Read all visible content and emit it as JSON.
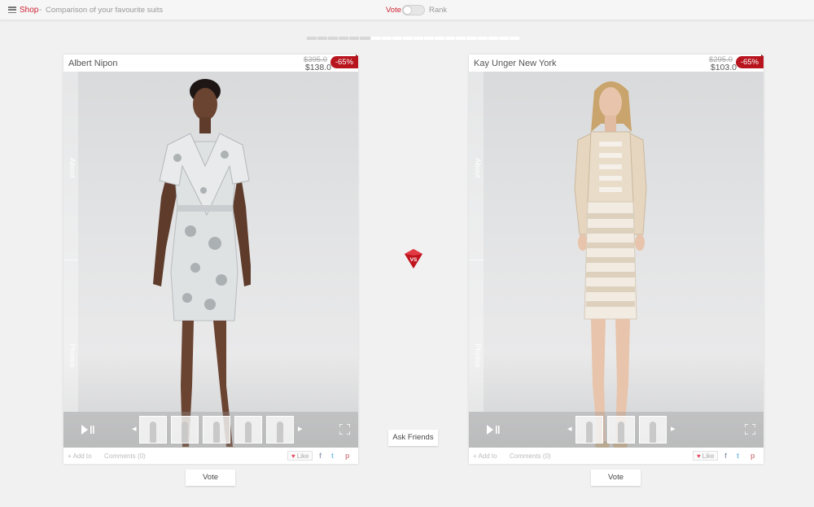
{
  "topbar": {
    "shop_label": "Shop",
    "separator": "-",
    "description": "Comparison of your favourite suits",
    "vote_label": "Vote",
    "rank_label": "Rank"
  },
  "progress": {
    "completed_segments": 6,
    "total_segments": 20
  },
  "left_product": {
    "brand": "Albert Nipon",
    "old_price": "$395.0",
    "new_price": "$138.0",
    "discount": "-65%",
    "side_about": "About",
    "side_photos": "Photos",
    "thumbnail_count": 5,
    "add_to": "+ Add to",
    "comments": "Comments (0)",
    "like": "Like",
    "vote_button": "Vote"
  },
  "right_product": {
    "brand": "Kay Unger New York",
    "old_price": "$295.0",
    "new_price": "$103.0",
    "discount": "-65%",
    "side_about": "About",
    "side_photos": "Photos",
    "thumbnail_count": 3,
    "add_to": "+ Add to",
    "comments": "Comments (0)",
    "like": "Like",
    "vote_button": "Vote"
  },
  "vs_label": "VS",
  "ask_friends": "Ask Friends",
  "social": {
    "facebook": "f",
    "twitter": "t",
    "pinterest": "p"
  },
  "icons": {
    "menu": "menu-icon",
    "play": "play-icon",
    "fullscreen": "fullscreen-icon",
    "heart": "heart-icon",
    "vs": "vs-badge-icon"
  },
  "colors": {
    "accent": "#cc2233",
    "discount_badge": "#b8141e"
  }
}
